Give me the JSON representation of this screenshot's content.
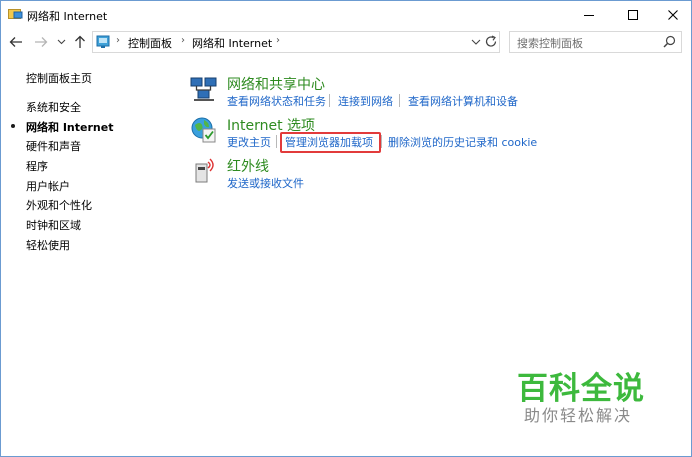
{
  "window": {
    "title": "网络和 Internet"
  },
  "address": {
    "crumbs": [
      "控制面板",
      "网络和 Internet"
    ],
    "search_placeholder": "搜索控制面板"
  },
  "sidebar": {
    "items": [
      {
        "label": "控制面板主页",
        "active": false
      },
      {
        "label": "系统和安全",
        "active": false
      },
      {
        "label": "网络和 Internet",
        "active": true
      },
      {
        "label": "硬件和声音",
        "active": false
      },
      {
        "label": "程序",
        "active": false
      },
      {
        "label": "用户帐户",
        "active": false
      },
      {
        "label": "外观和个性化",
        "active": false
      },
      {
        "label": "时钟和区域",
        "active": false
      },
      {
        "label": "轻松使用",
        "active": false
      }
    ]
  },
  "categories": [
    {
      "title": "网络和共享中心",
      "icon": "network-icon",
      "links": [
        "查看网络状态和任务",
        "连接到网络",
        "查看网络计算机和设备"
      ]
    },
    {
      "title": "Internet 选项",
      "icon": "internet-options-icon",
      "links": [
        "更改主页",
        "管理浏览器加载项",
        "删除浏览的历史记录和 cookie"
      ]
    },
    {
      "title": "红外线",
      "icon": "infrared-icon",
      "links": [
        "发送或接收文件"
      ]
    }
  ],
  "watermark": {
    "main": "百科全说",
    "sub": "助你轻松解决"
  },
  "colors": {
    "link": "#1e66c8",
    "category_title": "#2e8b20",
    "highlight": "#e23b3b",
    "watermark": "#3db93d"
  }
}
